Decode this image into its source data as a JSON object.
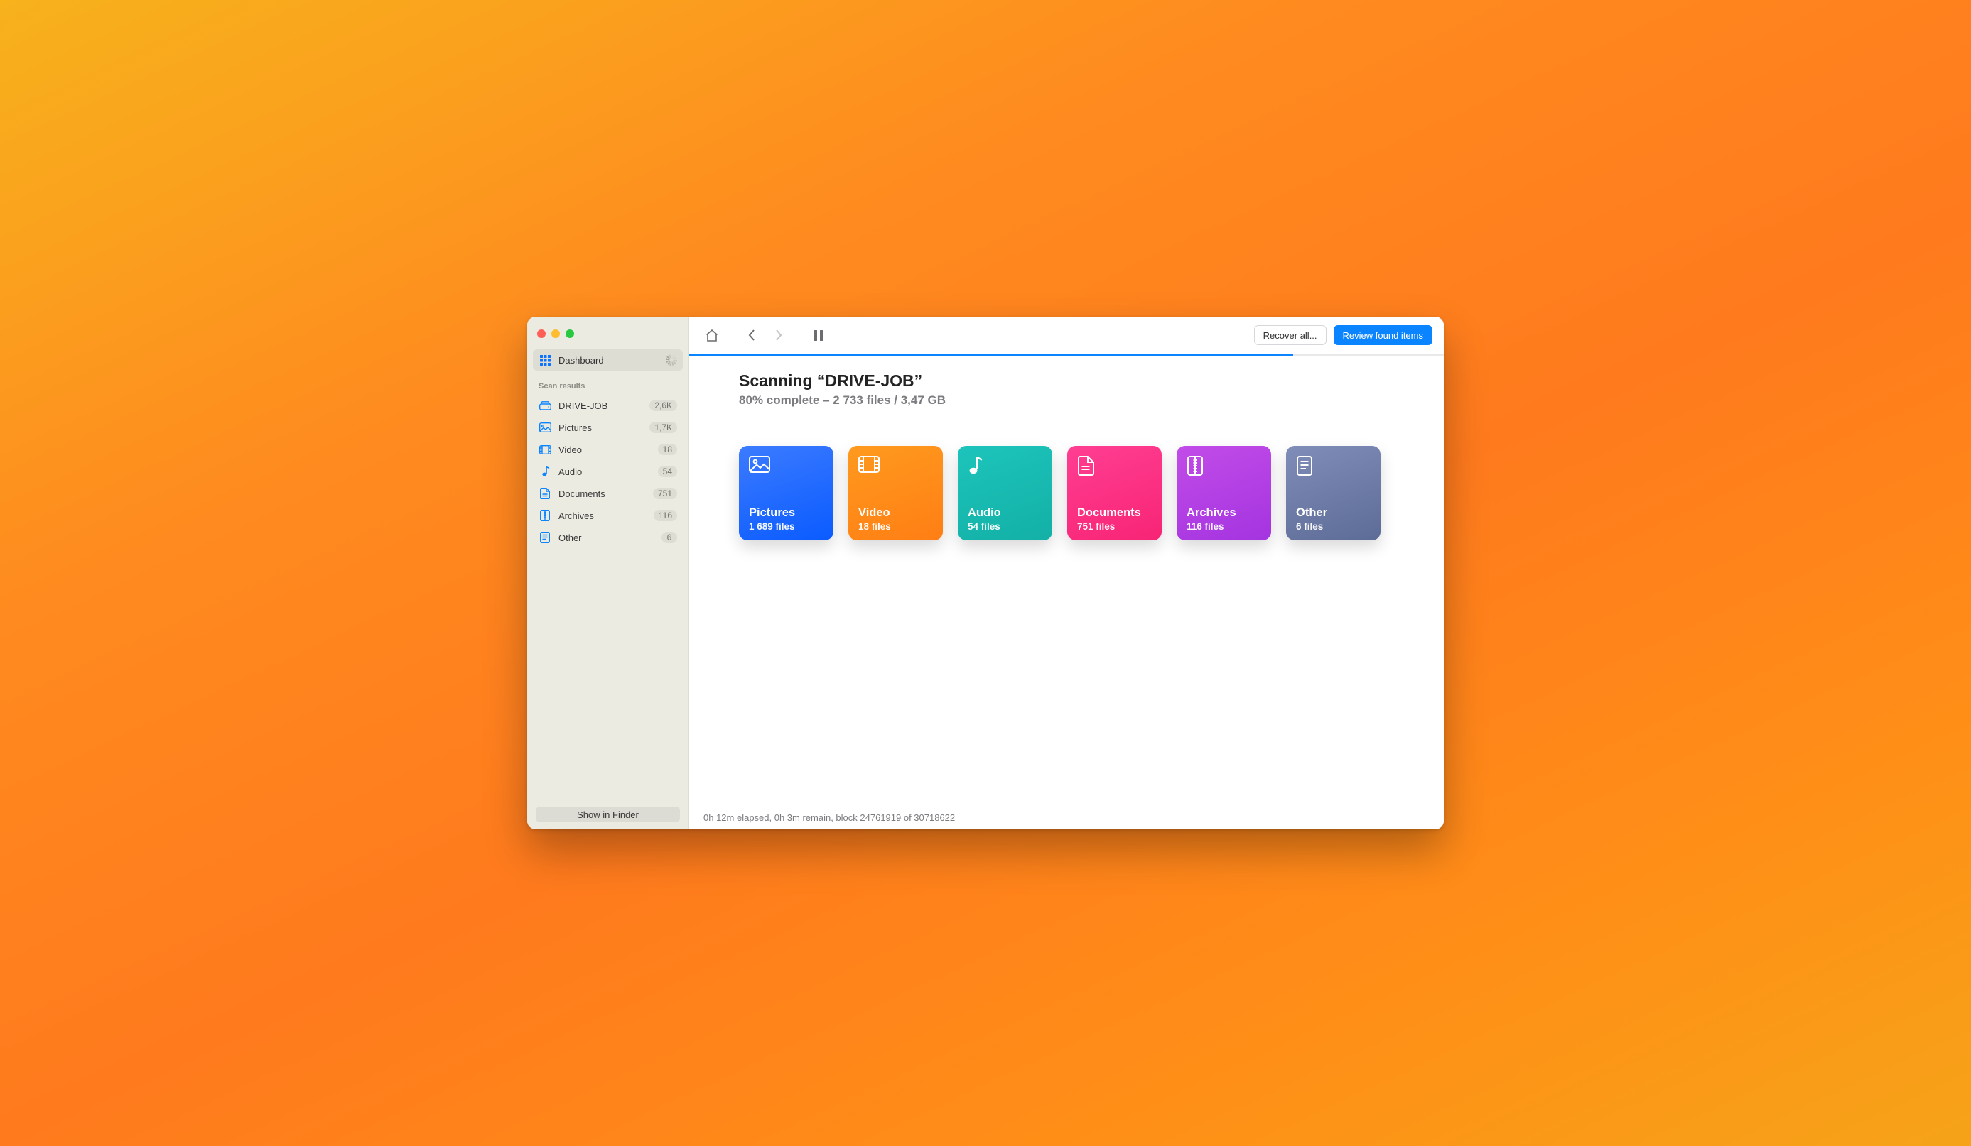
{
  "sidebar": {
    "dashboard_label": "Dashboard",
    "section_label": "Scan results",
    "items": [
      {
        "icon": "drive-icon",
        "label": "DRIVE-JOB",
        "count": "2,6K"
      },
      {
        "icon": "image-icon",
        "label": "Pictures",
        "count": "1,7K"
      },
      {
        "icon": "video-icon",
        "label": "Video",
        "count": "18"
      },
      {
        "icon": "audio-icon",
        "label": "Audio",
        "count": "54"
      },
      {
        "icon": "doc-icon",
        "label": "Documents",
        "count": "751"
      },
      {
        "icon": "archive-icon",
        "label": "Archives",
        "count": "116"
      },
      {
        "icon": "other-icon",
        "label": "Other",
        "count": "6"
      }
    ],
    "show_in_finder": "Show in Finder"
  },
  "toolbar": {
    "recover_label": "Recover all...",
    "review_label": "Review found items"
  },
  "scan": {
    "title": "Scanning “DRIVE-JOB”",
    "subtitle": "80% complete – 2 733 files / 3,47 GB",
    "progress_percent": 80
  },
  "cards": [
    {
      "key": "pictures",
      "title": "Pictures",
      "sub": "1 689 files"
    },
    {
      "key": "video",
      "title": "Video",
      "sub": "18 files"
    },
    {
      "key": "audio",
      "title": "Audio",
      "sub": "54 files"
    },
    {
      "key": "documents",
      "title": "Documents",
      "sub": "751 files"
    },
    {
      "key": "archives",
      "title": "Archives",
      "sub": "116 files"
    },
    {
      "key": "other",
      "title": "Other",
      "sub": "6 files"
    }
  ],
  "status": "0h 12m elapsed, 0h 3m remain, block 24761919 of 30718622"
}
